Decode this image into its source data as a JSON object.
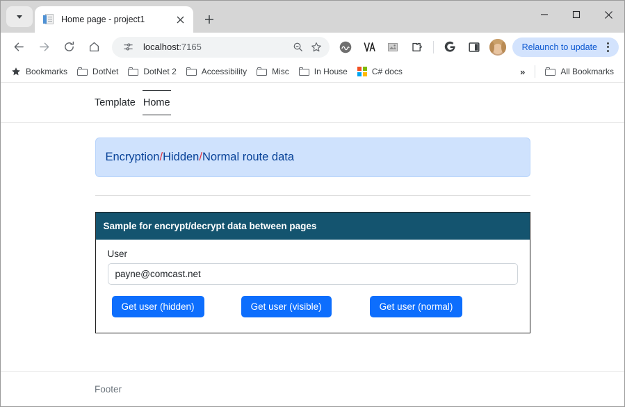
{
  "browser": {
    "tab": {
      "title": "Home page - project1",
      "favicon_name": "document-favicon",
      "close_label": "✕"
    },
    "tab_list_button_label": "Search tabs",
    "new_tab_label": "+",
    "window_controls": {
      "minimize": "—",
      "maximize": "□",
      "close": "✕"
    },
    "toolbar": {
      "back_label": "←",
      "forward_label": "→",
      "reload_label": "↻",
      "home_label": "⌂",
      "url": "localhost:7165",
      "url_host": "localhost",
      "url_port": ":7165",
      "site_info_label": "View site information",
      "zoom_label": "Zoom",
      "bookmark_label": "Bookmark this tab",
      "extensions": [
        {
          "name": "wave-extension-icon",
          "glyph": "Ⓦ"
        },
        {
          "name": "axe-extension-icon",
          "glyph": "∆"
        },
        {
          "name": "image-extension-icon",
          "glyph": "▦"
        },
        {
          "name": "puzzle-extensions-icon",
          "glyph": "⚙"
        }
      ],
      "google_label": "G",
      "side_panel_label": "Side panel",
      "profile_label": "Profile",
      "relaunch_label": "Relaunch to update",
      "menu_label": "Customize and control Google Chrome"
    },
    "bookmarks": [
      {
        "label": "Bookmarks",
        "icon": "star-icon"
      },
      {
        "label": "DotNet",
        "icon": "folder-icon"
      },
      {
        "label": "DotNet 2",
        "icon": "folder-icon"
      },
      {
        "label": "Accessibility",
        "icon": "folder-icon"
      },
      {
        "label": "Misc",
        "icon": "folder-icon"
      },
      {
        "label": "In House",
        "icon": "folder-icon"
      },
      {
        "label": "C# docs",
        "icon": "microsoft-icon"
      }
    ],
    "bookmarks_overflow_label": "»",
    "all_bookmarks_label": "All Bookmarks"
  },
  "page": {
    "nav": {
      "brand": "Template",
      "active_link": "Home"
    },
    "alert": {
      "part1": "Encryption",
      "sep1": "/",
      "part2": "Hidden",
      "sep2": "/",
      "part3": "Normal route data"
    },
    "card": {
      "header": "Sample for encrypt/decrypt data between pages",
      "user_label": "User",
      "user_value": "payne@comcast.net",
      "user_placeholder": "",
      "buttons": [
        {
          "label": "Get user (hidden)"
        },
        {
          "label": "Get user (visible)"
        },
        {
          "label": "Get user (normal)"
        }
      ]
    },
    "footer": "Footer"
  },
  "colors": {
    "primary": "#0d6efd",
    "card_header_bg": "#14546f",
    "alert_bg": "#cfe2fd",
    "alert_text": "#084298",
    "alert_sep": "#dc3545",
    "relaunch_bg": "#d3e3fd",
    "relaunch_text": "#0b57d0"
  }
}
